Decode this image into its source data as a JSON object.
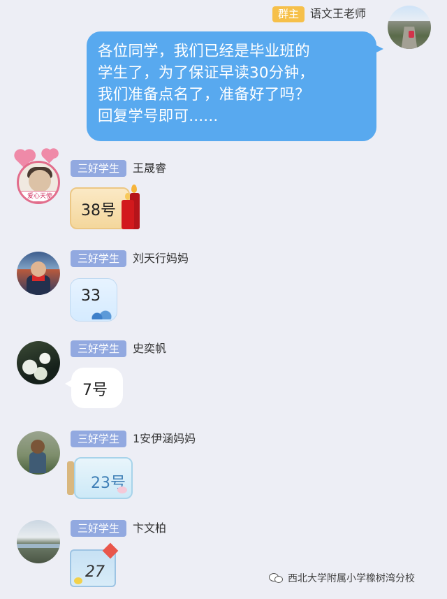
{
  "teacher": {
    "role_badge": "群主",
    "name": "语文王老师",
    "message_lines": [
      "各位同学，我们已经是毕业班的",
      "学生了，为了保证早读30分钟，",
      "我们准备点名了，准备好了吗？",
      "回复学号即可......"
    ]
  },
  "students": [
    {
      "badge": "三好学生",
      "name": "王晟睿",
      "reply": "38号",
      "avatar_caption": "爱心天使"
    },
    {
      "badge": "三好学生",
      "name": "刘天行妈妈",
      "reply": "33"
    },
    {
      "badge": "三好学生",
      "name": "史奕帆",
      "reply": "7号"
    },
    {
      "badge": "三好学生",
      "name": "1安伊涵妈妈",
      "reply": "23号"
    },
    {
      "badge": "三好学生",
      "name": "卞文柏",
      "reply": "27"
    }
  ],
  "watermark": {
    "text": "西北大学附属小学橡树湾分校"
  },
  "colors": {
    "background": "#edeef5",
    "teacher_bubble": "#58a9ef",
    "owner_badge": "#f6c04a",
    "member_badge": "#92a9e0"
  }
}
